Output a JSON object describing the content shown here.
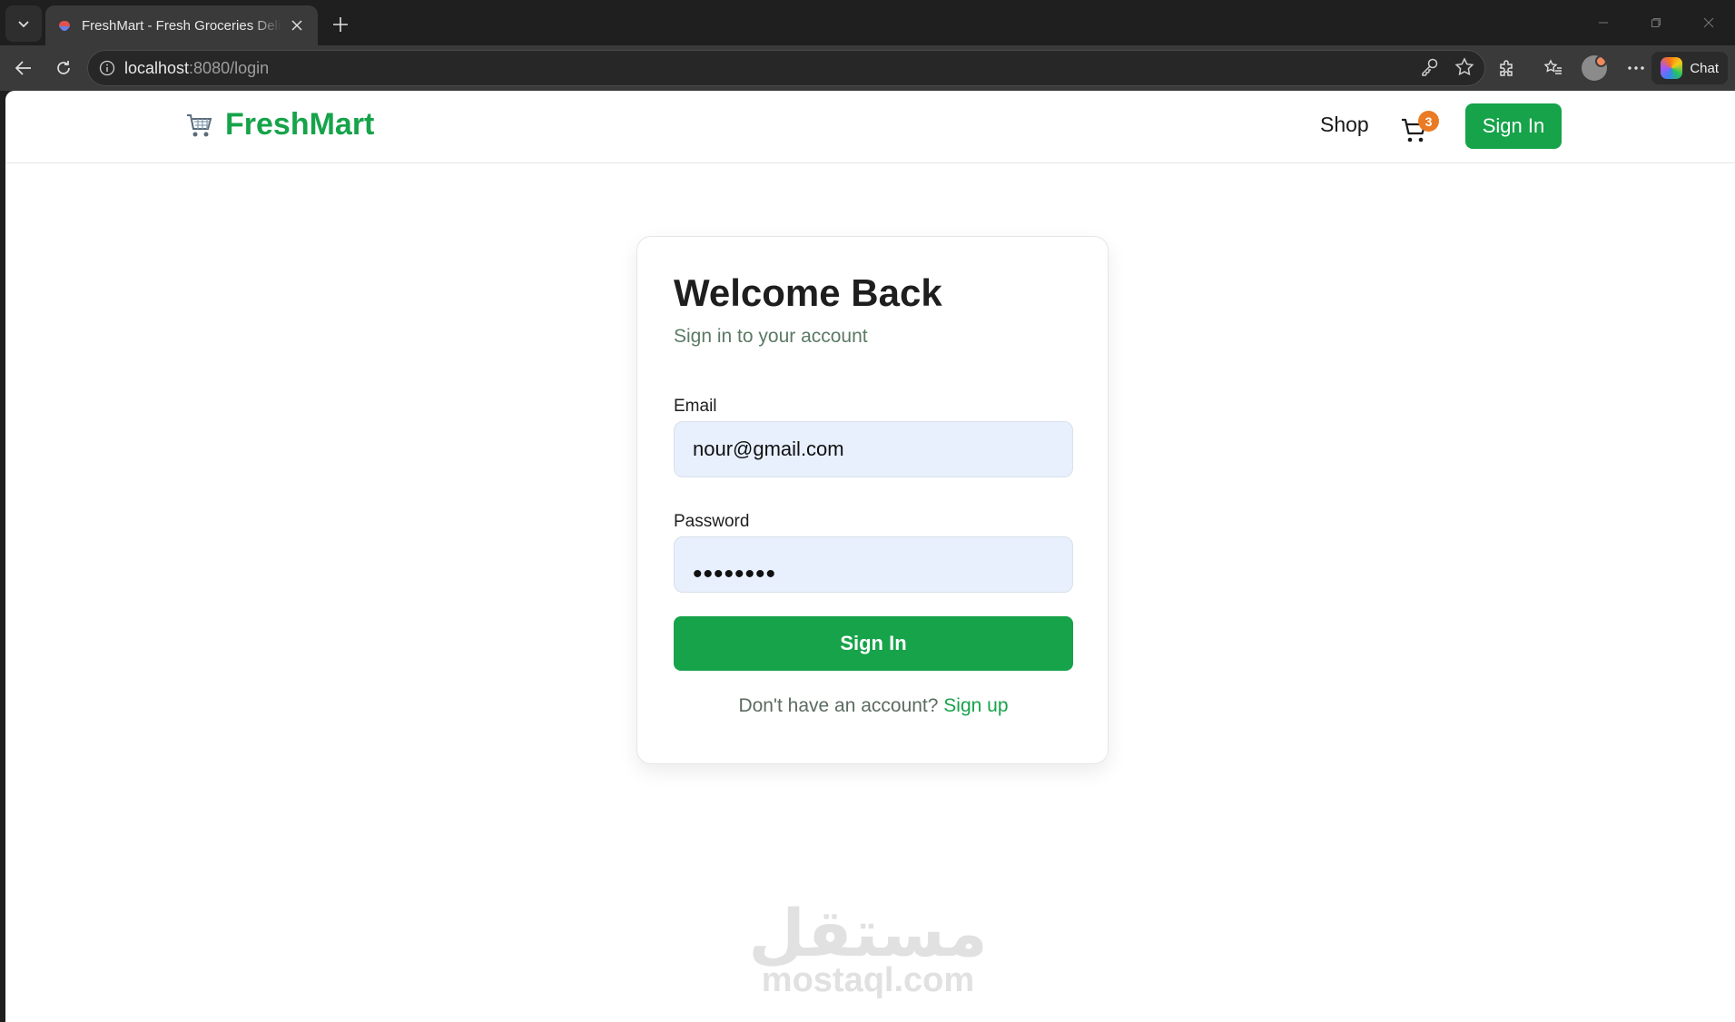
{
  "browser": {
    "tab_title": "FreshMart - Fresh Groceries Delivered",
    "url_host": "localhost",
    "url_rest": ":8080/login",
    "chat_label": "Chat"
  },
  "header": {
    "brand": "FreshMart",
    "nav_shop": "Shop",
    "cart_count": "3",
    "signin_label": "Sign In"
  },
  "login": {
    "title": "Welcome Back",
    "subtitle": "Sign in to your account",
    "email_label": "Email",
    "email_value": "nour@gmail.com",
    "password_label": "Password",
    "password_mask": "••••••••",
    "submit_label": "Sign In",
    "no_account_text": "Don't have an account?",
    "signup_link": "Sign up"
  },
  "watermark": {
    "arabic": "مستقل",
    "latin": "mostaql.com"
  },
  "colors": {
    "brand_green": "#16a34a",
    "badge_orange": "#ea7a24",
    "input_bg": "#e8f0fe"
  }
}
